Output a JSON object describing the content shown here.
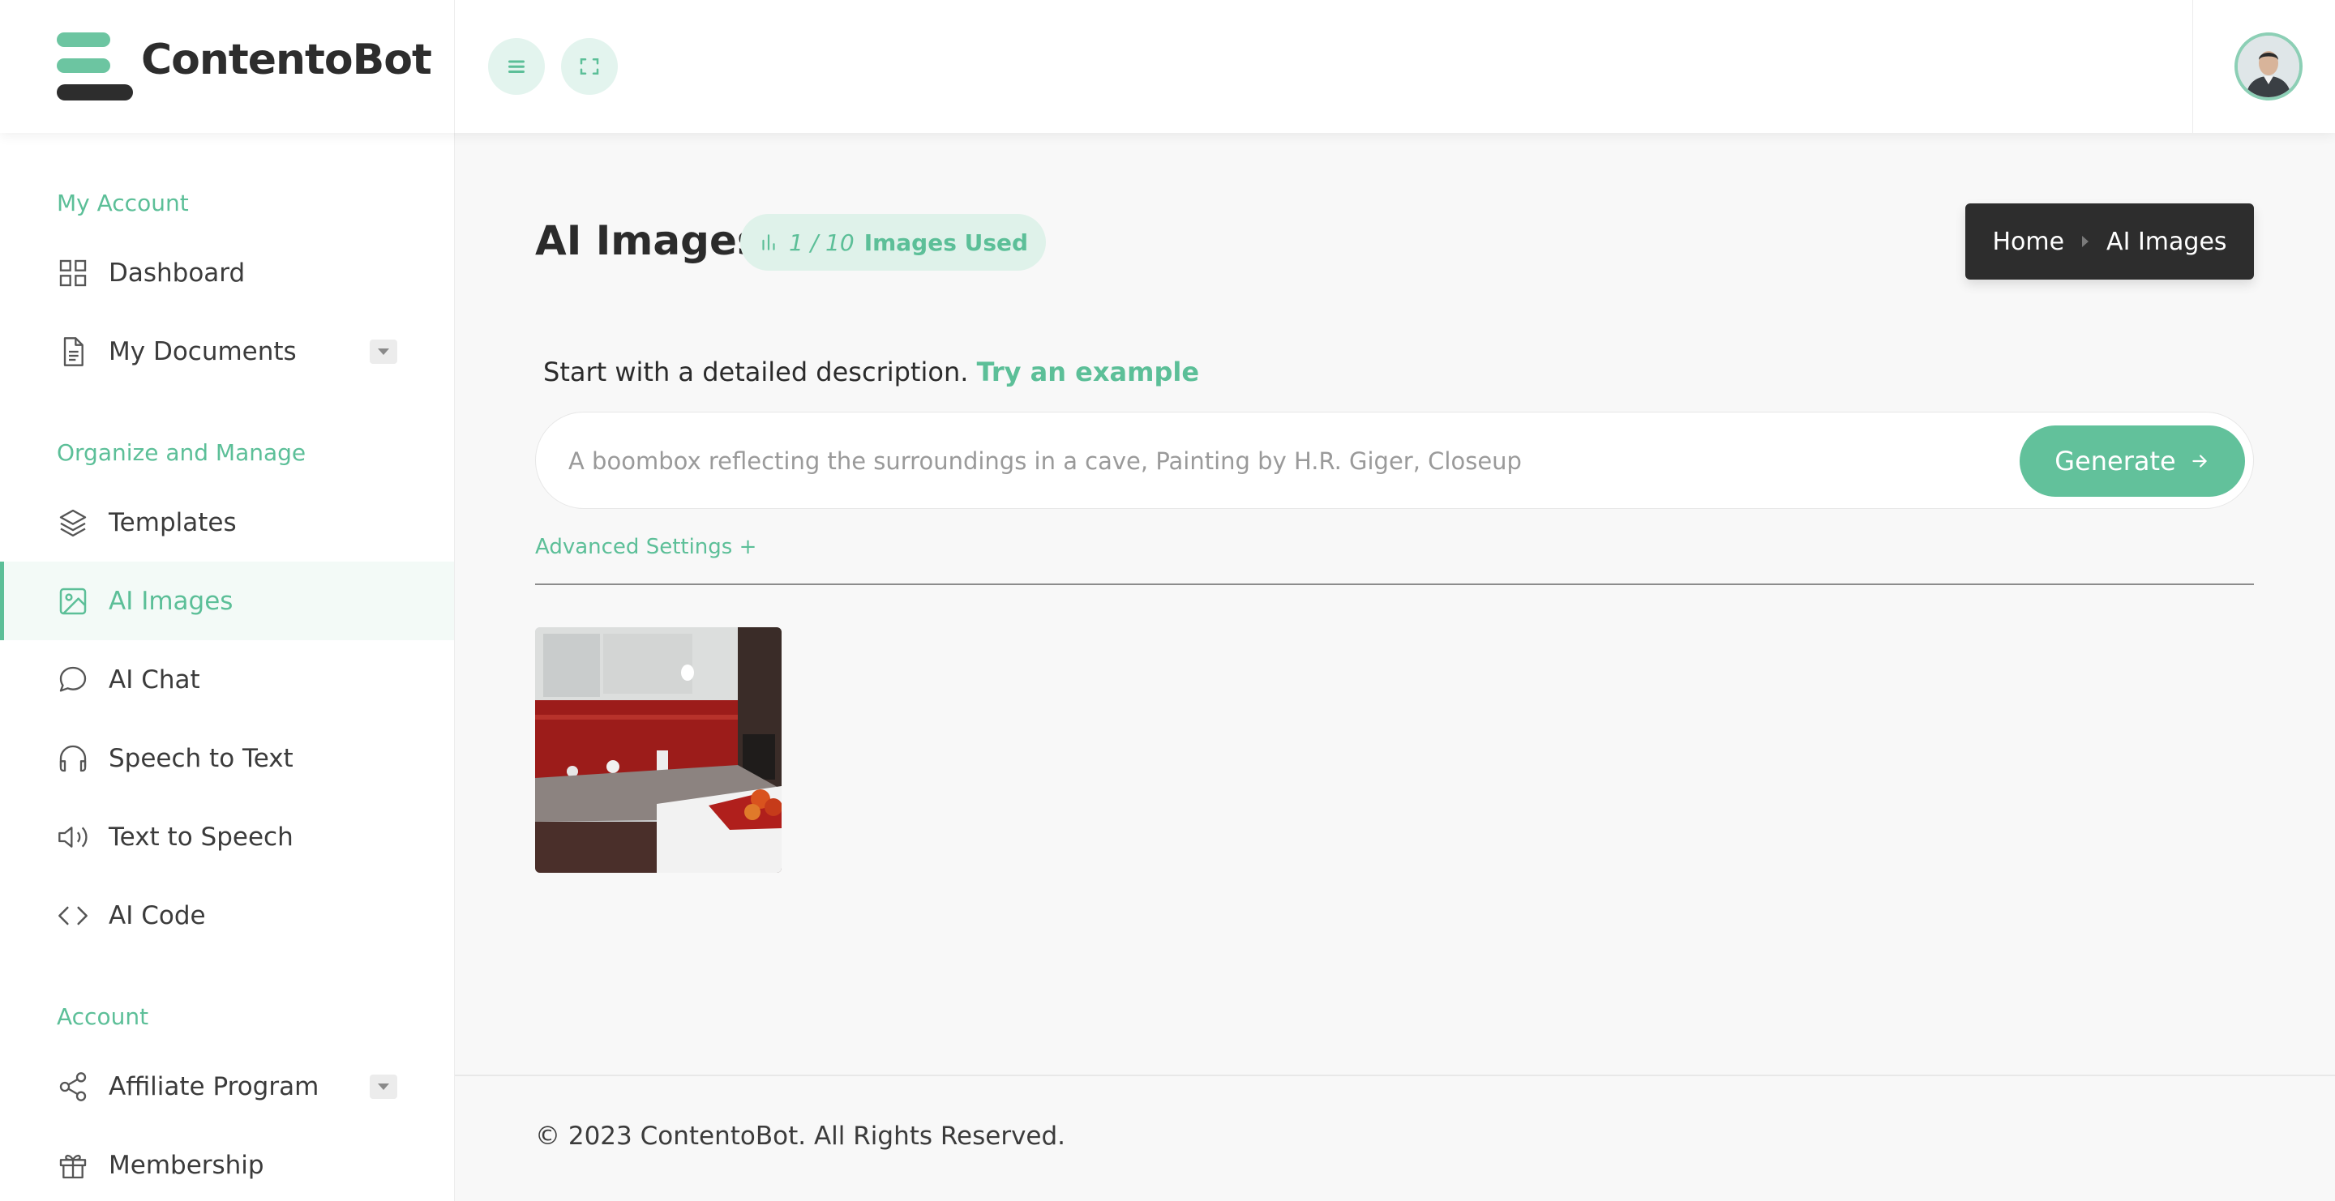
{
  "brand": {
    "name": "ContentoBot"
  },
  "colors": {
    "accent": "#5cbf98",
    "accent_light": "#e3f4ee",
    "dark": "#2d2d2d"
  },
  "topbar": {
    "menu_icon": "hamburger-icon",
    "fullscreen_icon": "fullscreen-icon"
  },
  "sidebar": {
    "sections": [
      {
        "title": "My Account",
        "items": [
          {
            "label": "Dashboard",
            "icon": "grid-icon"
          },
          {
            "label": "My Documents",
            "icon": "document-icon",
            "has_caret": true
          }
        ]
      },
      {
        "title": "Organize and Manage",
        "items": [
          {
            "label": "Templates",
            "icon": "layers-icon"
          },
          {
            "label": "AI Images",
            "icon": "image-icon",
            "active": true
          },
          {
            "label": "AI Chat",
            "icon": "chat-bubble-icon"
          },
          {
            "label": "Speech to Text",
            "icon": "headphones-icon"
          },
          {
            "label": "Text to Speech",
            "icon": "speaker-icon"
          },
          {
            "label": "AI Code",
            "icon": "code-icon"
          }
        ]
      },
      {
        "title": "Account",
        "items": [
          {
            "label": "Affiliate Program",
            "icon": "share-icon",
            "has_caret": true
          },
          {
            "label": "Membership",
            "icon": "gift-icon"
          }
        ]
      }
    ]
  },
  "main": {
    "title": "AI Images",
    "usage": {
      "count": "1 / 10",
      "label": "Images Used",
      "used": 1,
      "limit": 10
    },
    "breadcrumb": {
      "home": "Home",
      "current": "AI Images"
    },
    "hint": {
      "text": "Start with a detailed description.",
      "link": "Try an example"
    },
    "prompt": {
      "value": "",
      "placeholder": "A boombox reflecting the surroundings in a cave, Painting by H.R. Giger, Closeup"
    },
    "generate_label": "Generate",
    "advanced_label": "Advanced Settings +"
  },
  "footer": {
    "text": "© 2023 ContentoBot. All Rights Reserved."
  }
}
